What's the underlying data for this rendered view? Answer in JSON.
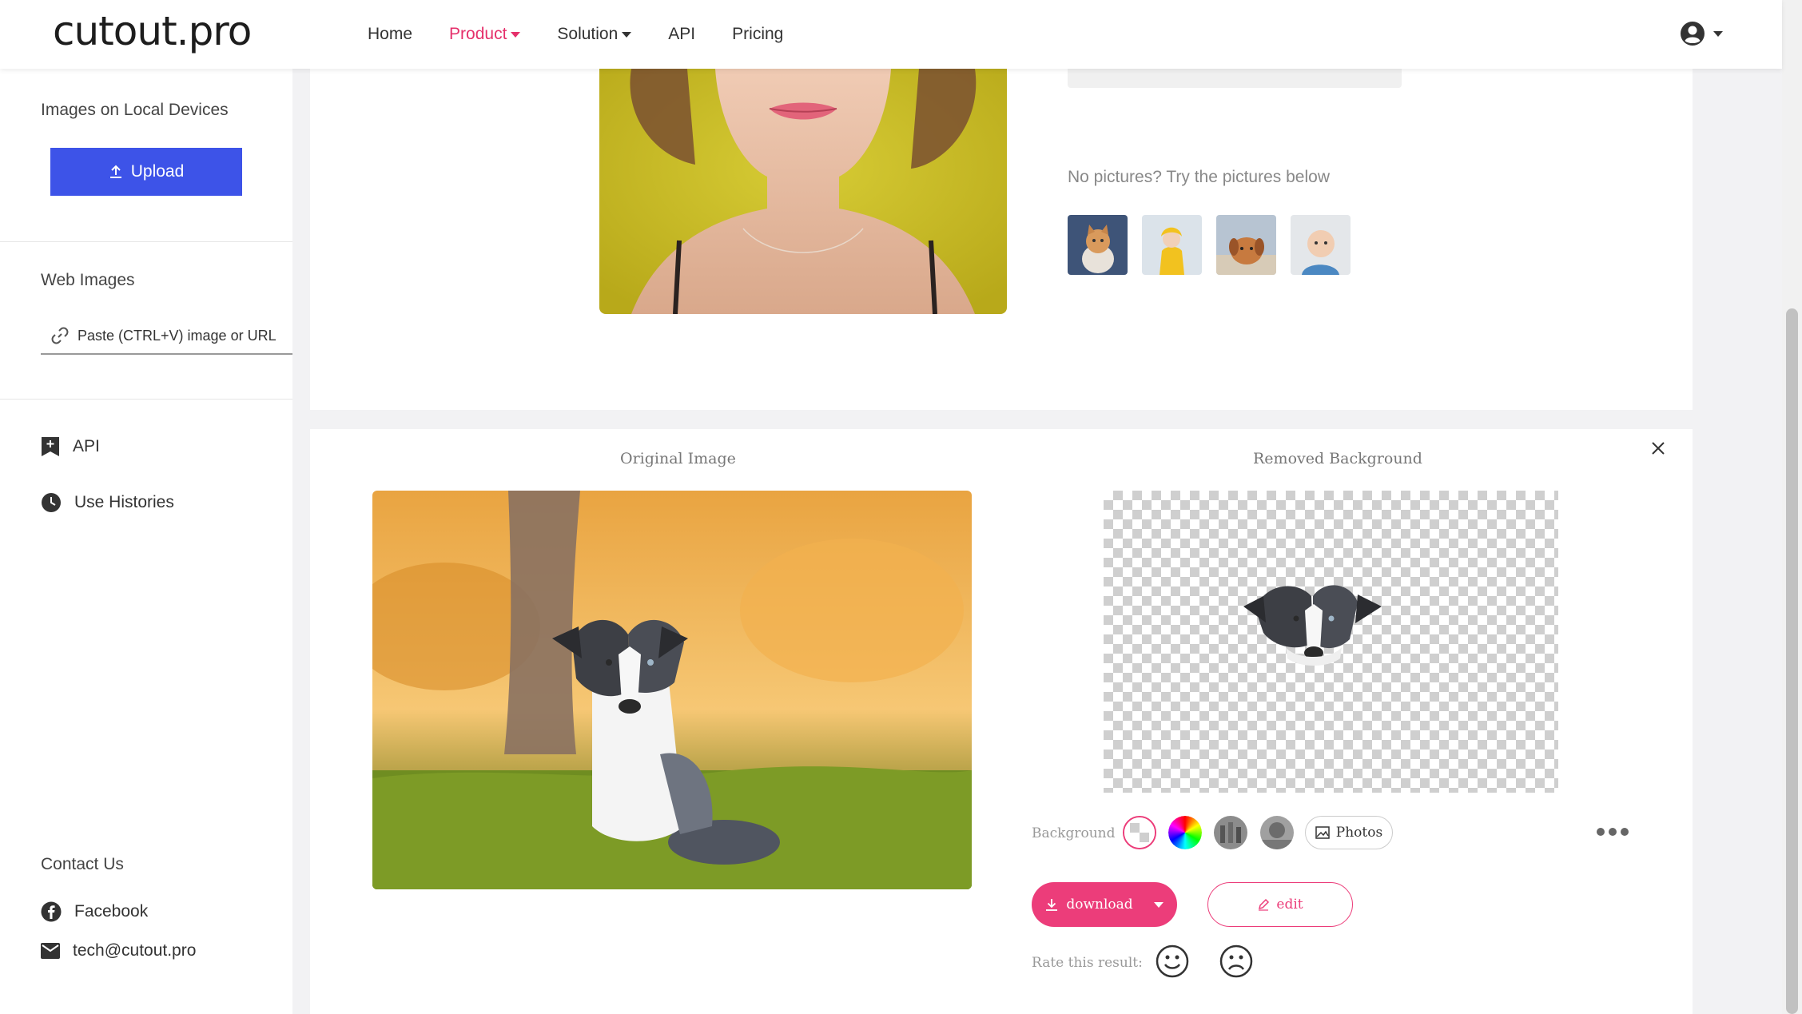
{
  "brand": {
    "logo": "cutout.pro",
    "accent": "#e5306b",
    "primary_button": "#3d53e8"
  },
  "nav": {
    "items": [
      {
        "label": "Home",
        "active": false,
        "dropdown": false
      },
      {
        "label": "Product",
        "active": true,
        "dropdown": true
      },
      {
        "label": "Solution",
        "active": false,
        "dropdown": true
      },
      {
        "label": "API",
        "active": false,
        "dropdown": false
      },
      {
        "label": "Pricing",
        "active": false,
        "dropdown": false
      }
    ],
    "account_icon": "user-circle-icon"
  },
  "sidebar": {
    "local_title": "Images on Local Devices",
    "upload_label": "Upload",
    "web_title": "Web Images",
    "paste_label": "Paste (CTRL+V) image or URL",
    "api_label": "API",
    "histories_label": "Use Histories",
    "contact_title": "Contact Us",
    "facebook_label": "Facebook",
    "email_label": "tech@cutout.pro"
  },
  "samples": {
    "prompt": "No pictures? Try the pictures below",
    "thumbs": [
      "cat",
      "child-in-yellow",
      "puppy",
      "baby"
    ]
  },
  "result": {
    "original_title": "Original Image",
    "removed_title": "Removed Background",
    "background_label": "Background",
    "photos_label": "Photos",
    "download_label": "download",
    "edit_label": "edit",
    "rate_label": "Rate this result:"
  }
}
